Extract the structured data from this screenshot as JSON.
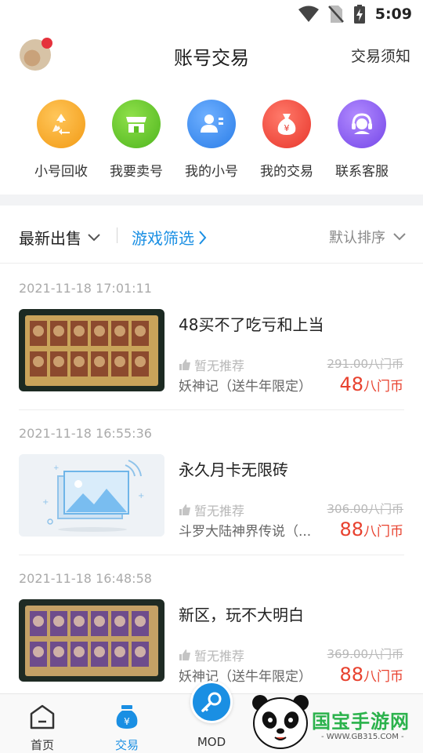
{
  "status_bar": {
    "time": "5:09"
  },
  "header": {
    "title": "账号交易",
    "right_link": "交易须知"
  },
  "quick_menu": [
    {
      "label": "小号回收",
      "icon": "recycle-icon",
      "color": "#f5a623"
    },
    {
      "label": "我要卖号",
      "icon": "store-icon",
      "color": "#6ccb2c"
    },
    {
      "label": "我的小号",
      "icon": "user-card-icon",
      "color": "#3d8ff0"
    },
    {
      "label": "我的交易",
      "icon": "money-bag-icon",
      "color": "#f0473c"
    },
    {
      "label": "联系客服",
      "icon": "headset-icon",
      "color": "#8a5cf0"
    }
  ],
  "filter": {
    "latest": "最新出售",
    "game_filter": "游戏筛选",
    "sort": "默认排序"
  },
  "listings": [
    {
      "date": "2021-11-18 17:01:11",
      "title": "48买不了吃亏和上当",
      "recommend": "暂无推荐",
      "game": "妖神记（送牛年限定）",
      "original_price": "291.00八门币",
      "price_num": "48",
      "price_unit": "八门币"
    },
    {
      "date": "2021-11-18 16:55:36",
      "title": "永久月卡无限砖",
      "recommend": "暂无推荐",
      "game": "斗罗大陆神界传说（...",
      "original_price": "306.00八门币",
      "price_num": "88",
      "price_unit": "八门币"
    },
    {
      "date": "2021-11-18 16:48:58",
      "title": "新区，玩不大明白",
      "recommend": "暂无推荐",
      "game": "妖神记（送牛年限定）",
      "original_price": "369.00八门币",
      "price_num": "88",
      "price_unit": "八门币"
    }
  ],
  "bottom_nav": {
    "home": "首页",
    "trade": "交易",
    "mod": "MOD"
  },
  "watermark": {
    "brand": "国宝手游网",
    "url": "- WWW.GB315.COM -"
  }
}
